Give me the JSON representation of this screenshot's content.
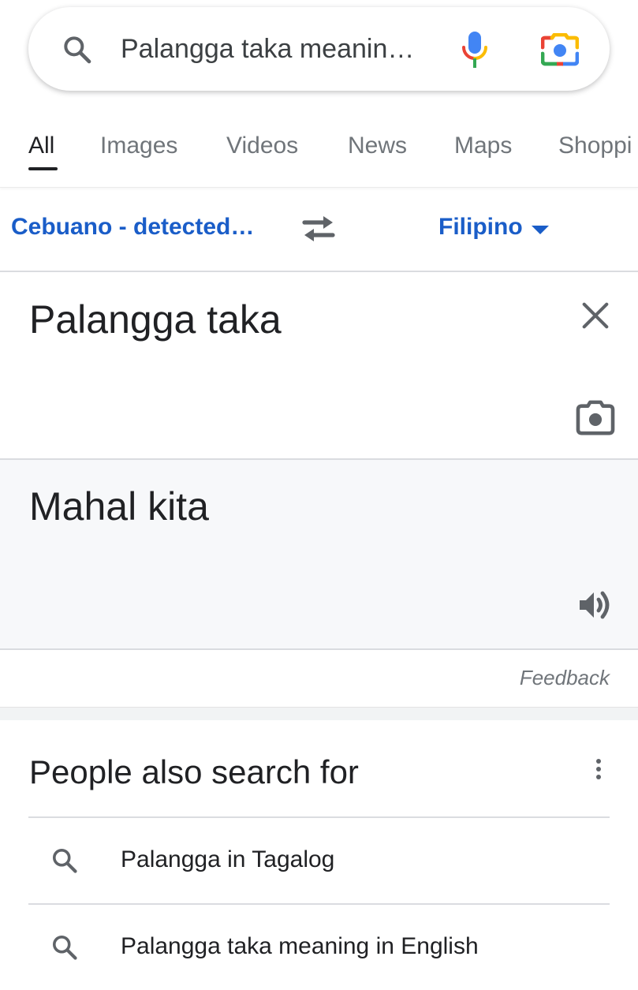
{
  "search": {
    "query": "Palangga taka meanin…"
  },
  "tabs": [
    {
      "label": "All",
      "active": true
    },
    {
      "label": "Images"
    },
    {
      "label": "Videos"
    },
    {
      "label": "News"
    },
    {
      "label": "Maps"
    },
    {
      "label": "Shoppi"
    }
  ],
  "translate": {
    "source_language": "Cebuano - detected…",
    "target_language": "Filipino",
    "source_text": "Palangga taka",
    "translated_text": "Mahal kita",
    "feedback_label": "Feedback"
  },
  "people_also_search": {
    "title": "People also search for",
    "items": [
      {
        "label": "Palangga in Tagalog"
      },
      {
        "label": "Palangga taka meaning in English"
      }
    ]
  },
  "icons": {
    "search": "search-icon",
    "mic": "microphone-icon",
    "lens": "google-lens-icon",
    "swap": "swap-languages-icon",
    "dropdown": "caret-down-icon",
    "clear": "close-icon",
    "camera": "camera-icon",
    "speaker": "speaker-icon",
    "more": "more-vertical-icon"
  },
  "colors": {
    "link_blue": "#1a5dc8",
    "google_blue": "#4285f4",
    "google_red": "#ea4335",
    "google_yellow": "#fbbc04",
    "google_green": "#34a853",
    "translation_bg": "#f7f8fa"
  }
}
